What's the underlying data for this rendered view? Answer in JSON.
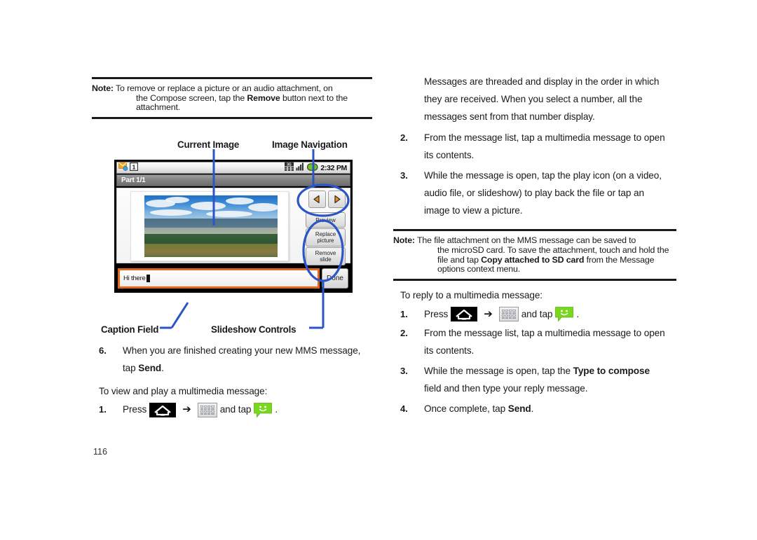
{
  "document": {
    "page_number": "116"
  },
  "left_column": {
    "note": {
      "label": "Note:",
      "line1": "To remove or replace a picture or an audio attachment, on",
      "line2_pre": "the Compose screen, tap the ",
      "line2_bold": "Remove",
      "line2_post": " button next to the",
      "line3": "attachment."
    },
    "figure": {
      "labels": {
        "current_image": "Current Image",
        "image_navigation": "Image Navigation",
        "caption_field": "Caption Field",
        "slideshow_controls": "Slideshow Controls"
      },
      "phone": {
        "status_time": "2:32 PM",
        "notification_badge": "1",
        "title": "Part 1/1",
        "caption_text": "Hi there",
        "done_label": "Done",
        "buttons": {
          "preview": "Preview",
          "replace_picture_line1": "Replace",
          "replace_picture_line2": "picture",
          "remove_slide_line1": "Remove",
          "remove_slide_line2": "slide"
        },
        "colors": {
          "caption_border": "#e2661d",
          "callout_blue": "#2b55c6",
          "battery_green": "#6ec51b",
          "nav_arrow_orange": "#f08a18"
        }
      }
    },
    "step6": {
      "num": "6.",
      "line1": "When you are finished creating your new MMS message,",
      "line2_pre": "tap ",
      "line2_bold": "Send",
      "line2_post": "."
    },
    "view_intro": "To view and play a multimedia message:",
    "step1": {
      "num": "1.",
      "press_label": "Press",
      "arrow": "➔",
      "and_tap_label": "and tap",
      "period": "."
    }
  },
  "right_column": {
    "intro_para": {
      "line1": "Messages are threaded and display in the order in which",
      "line2": "they are received. When you select a number, all the",
      "line3": "messages sent from that number display."
    },
    "step2": {
      "num": "2.",
      "line1": "From the message list, tap a multimedia message to open",
      "line2": "its contents."
    },
    "step3": {
      "num": "3.",
      "line1": "While the message is open, tap the play icon (on a video,",
      "line2": "audio file, or slideshow) to play back the file or tap an",
      "line3": "image to view a picture."
    },
    "note": {
      "label": "Note:",
      "line1": "The file attachment on the MMS message can be saved to",
      "line2": "the microSD card. To save the attachment, touch and hold the",
      "line3_pre": "file and tap ",
      "line3_bold": "Copy attached to SD card",
      "line3_post": " from the Message",
      "line4": "options context menu."
    },
    "reply_intro": "To reply to a multimedia message:",
    "r_step1": {
      "num": "1.",
      "press_label": "Press",
      "arrow": "➔",
      "and_tap_label": "and tap",
      "period": "."
    },
    "r_step2": {
      "num": "2.",
      "line1": "From the message list, tap a multimedia message to open",
      "line2": "its contents."
    },
    "r_step3": {
      "num": "3.",
      "line1_pre": "While the message is open, tap the ",
      "line1_bold": "Type to compose",
      "line2": "field and then type your reply message."
    },
    "r_step4": {
      "num": "4.",
      "pre": "Once complete, tap ",
      "bold": "Send",
      "post": "."
    }
  },
  "icons": {
    "home": "home-icon",
    "apps_grid": "apps-grid-icon",
    "messaging": "messaging-icon",
    "arrow": "arrow-right-icon",
    "signal": "signal-bars-icon",
    "network_3g": "3g-network-icon",
    "battery": "battery-icon",
    "mms_notification": "mms-notification-icon"
  }
}
